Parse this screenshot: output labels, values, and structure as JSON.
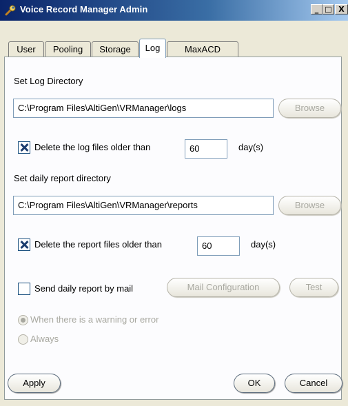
{
  "window": {
    "title": "Voice Record Manager Admin",
    "controls": {
      "minimize": "_",
      "maximize": "□",
      "close": "X"
    }
  },
  "tabs": [
    "User",
    "Pooling",
    "Storage",
    "Log",
    "MaxACD"
  ],
  "active_tab": "Log",
  "log": {
    "section_label": "Set Log Directory",
    "directory": "C:\\Program Files\\AltiGen\\VRManager\\logs",
    "browse_label": "Browse",
    "delete_label": "Delete the log files older than",
    "delete_checked": true,
    "days": "60",
    "days_unit": "day(s)"
  },
  "report": {
    "section_label": "Set daily report directory",
    "directory": "C:\\Program Files\\AltiGen\\VRManager\\reports",
    "browse_label": "Browse",
    "delete_label": "Delete the report files older than",
    "delete_checked": true,
    "days": "60",
    "days_unit": "day(s)"
  },
  "mail": {
    "send_label": "Send daily report by mail",
    "send_checked": false,
    "config_label": "Mail Configuration",
    "test_label": "Test",
    "option_warning": "When there is a warning or error",
    "option_always": "Always",
    "selected_option": "warning"
  },
  "footer": {
    "apply": "Apply",
    "ok": "OK",
    "cancel": "Cancel"
  },
  "colors": {
    "titlebar": "#0a246a",
    "titlebar_light": "#a6caf0",
    "check_mark": "#1c3d6e",
    "disabled_text": "#a8a8a0"
  }
}
